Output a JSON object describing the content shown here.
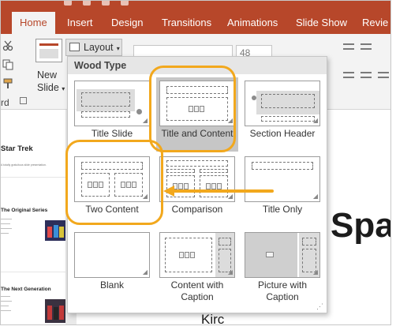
{
  "ribbon": {
    "tabs": [
      {
        "label": "Home",
        "active": true
      },
      {
        "label": "Insert"
      },
      {
        "label": "Design"
      },
      {
        "label": "Transitions"
      },
      {
        "label": "Animations"
      },
      {
        "label": "Slide Show"
      },
      {
        "label": "Revie"
      }
    ],
    "clipboard_label": "rd",
    "new_slide_label_1": "New",
    "new_slide_label_2": "Slide",
    "layout_button": "Layout",
    "font_size": "48"
  },
  "slides_panel": {
    "thumbs": [
      {
        "title": "Star Trek",
        "subtitle": "A totally gratuitous slide presentation."
      },
      {
        "title": "The Original Series"
      },
      {
        "title": "The Next Generation"
      }
    ]
  },
  "slide": {
    "big_text": "Spa",
    "small_text": "Kirc"
  },
  "layout_gallery": {
    "heading": "Wood Type",
    "items": [
      {
        "label": "Title Slide"
      },
      {
        "label": "Title and Content",
        "selected": true
      },
      {
        "label": "Section Header"
      },
      {
        "label": "Two Content"
      },
      {
        "label": "Comparison"
      },
      {
        "label": "Title Only"
      },
      {
        "label": "Blank"
      },
      {
        "label": "Content with Caption"
      },
      {
        "label": "Picture with Caption"
      }
    ]
  },
  "colors": {
    "ribbon": "#b7472a",
    "highlight": "#f2a81d",
    "selected_item": "#c6c6c6"
  }
}
